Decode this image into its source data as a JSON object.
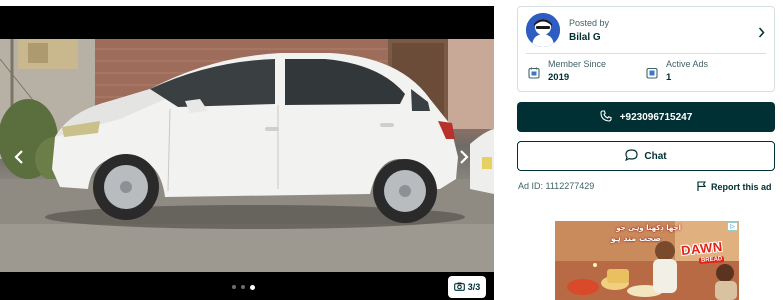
{
  "gallery": {
    "counter": "3/3",
    "slides": 3,
    "active_slide": 3
  },
  "seller": {
    "posted_by_label": "Posted by",
    "name": "Bilal G",
    "member_since_label": "Member Since",
    "member_since_value": "2019",
    "active_ads_label": "Active Ads",
    "active_ads_value": "1"
  },
  "actions": {
    "call_label": "+923096715247",
    "chat_label": "Chat"
  },
  "ad_meta": {
    "ad_id": "Ad ID: 1112277429",
    "report_label": "Report this ad"
  },
  "banner": {
    "headline_1": "اچھا دِکھتا وہی جو",
    "headline_2": "صحت مند ہو",
    "brand": "DAWN",
    "sub_brand": "BREAD"
  },
  "colors": {
    "primary": "#002f34",
    "muted_text": "#406367",
    "border": "#d8dfe0",
    "avatar": "#2e5cc0"
  },
  "icons": [
    "chevron-left-icon",
    "chevron-right-icon",
    "camera-icon",
    "phone-icon",
    "chat-icon",
    "flag-icon",
    "calendar-icon",
    "ads-icon",
    "avatar-icon"
  ]
}
